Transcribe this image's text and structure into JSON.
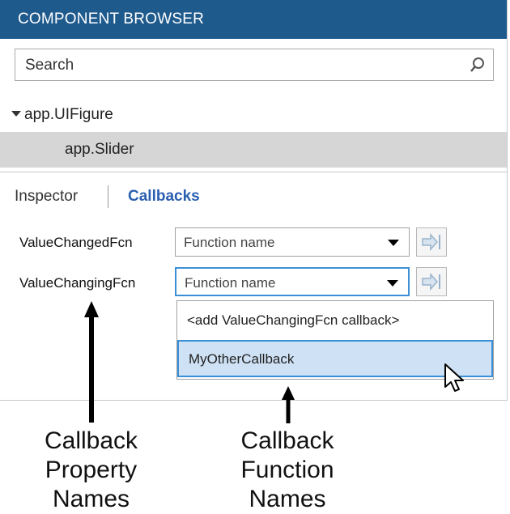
{
  "header": {
    "title": "COMPONENT BROWSER"
  },
  "search": {
    "placeholder": "Search",
    "icon": "search-icon"
  },
  "tree": {
    "root_label": "app.UIFigure",
    "child_label": "app.Slider"
  },
  "tabs": {
    "inspector": "Inspector",
    "callbacks": "Callbacks"
  },
  "callbacks": [
    {
      "property": "ValueChangedFcn",
      "value": "Function name"
    },
    {
      "property": "ValueChangingFcn",
      "value": "Function name"
    }
  ],
  "dropdown_options": [
    "<add ValueChangingFcn callback>",
    "MyOtherCallback"
  ],
  "annotations": {
    "left": [
      "Callback",
      "Property",
      "Names"
    ],
    "right": [
      "Callback",
      "Function",
      "Names"
    ]
  },
  "colors": {
    "header_bg": "#1f5a8d",
    "accent": "#2b5fb0",
    "focus": "#3b8fd6",
    "selected_bg": "#cfe2f5"
  }
}
